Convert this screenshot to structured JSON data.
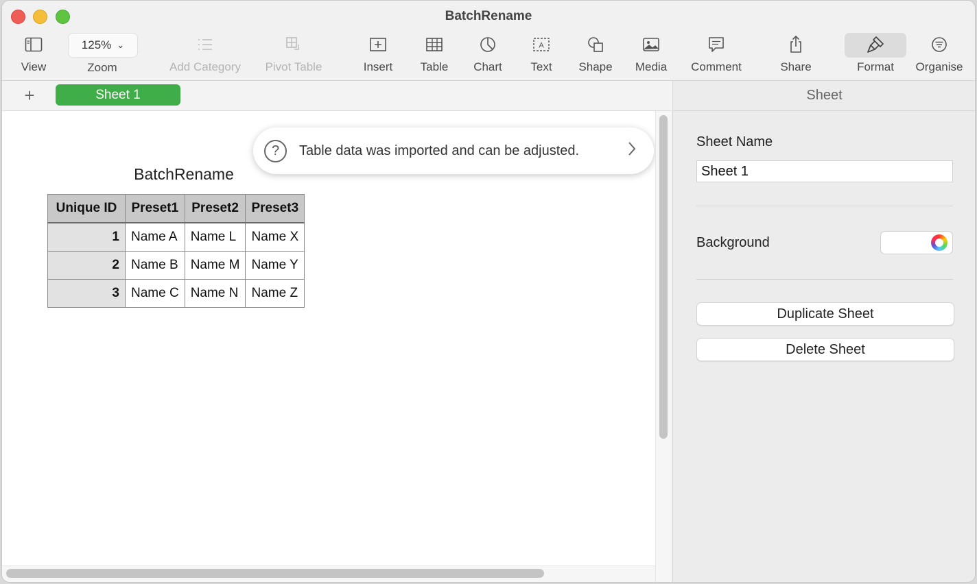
{
  "window": {
    "title": "BatchRename"
  },
  "toolbar": {
    "view": "View",
    "zoom_value": "125%",
    "zoom": "Zoom",
    "add_category": "Add Category",
    "pivot_table": "Pivot Table",
    "insert": "Insert",
    "table": "Table",
    "chart": "Chart",
    "text": "Text",
    "shape": "Shape",
    "media": "Media",
    "comment": "Comment",
    "share": "Share",
    "format": "Format",
    "organise": "Organise"
  },
  "tabs": {
    "add": "+",
    "sheets": [
      "Sheet 1"
    ]
  },
  "notice": {
    "message": "Table data was imported and can be adjusted."
  },
  "table": {
    "title": "BatchRename",
    "headers": [
      "Unique ID",
      "Preset1",
      "Preset2",
      "Preset3"
    ],
    "rows": [
      [
        "1",
        "Name A",
        "Name L",
        "Name X"
      ],
      [
        "2",
        "Name B",
        "Name M",
        "Name Y"
      ],
      [
        "3",
        "Name C",
        "Name N",
        "Name Z"
      ]
    ]
  },
  "sidebar": {
    "title": "Sheet",
    "sheet_name_label": "Sheet Name",
    "sheet_name_value": "Sheet 1",
    "background_label": "Background",
    "duplicate_button": "Duplicate Sheet",
    "delete_button": "Delete Sheet"
  },
  "colors": {
    "sheet_tab": "#3fae49",
    "close": "#ee5e57",
    "minimize": "#f4bd3a",
    "maximize": "#5fc440"
  }
}
